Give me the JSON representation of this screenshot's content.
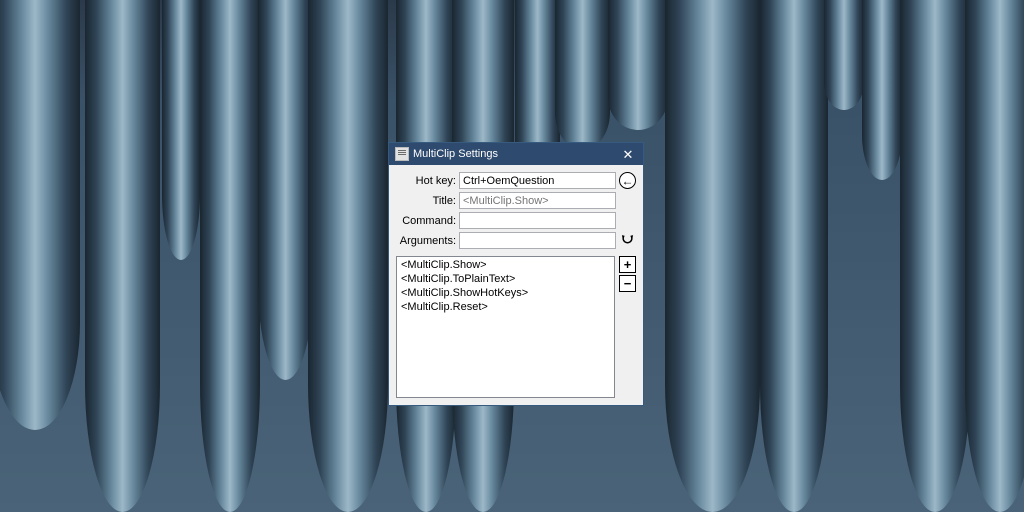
{
  "window": {
    "title": "MultiClip Settings"
  },
  "fields": {
    "labels": {
      "hotkey": "Hot key:",
      "title": "Title:",
      "command": "Command:",
      "arguments": "Arguments:"
    },
    "values": {
      "hotkey": "Ctrl+OemQuestion",
      "title": "",
      "command": "",
      "arguments": ""
    },
    "placeholders": {
      "title": "<MultiClip.Show>"
    }
  },
  "list": {
    "items": [
      "<MultiClip.Show>",
      "<MultiClip.ToPlainText>",
      "<MultiClip.ShowHotKeys>",
      "<MultiClip.Reset>"
    ]
  },
  "buttons": {
    "back": "←",
    "refresh": "↻",
    "add": "+",
    "remove": "−",
    "close": "✕"
  }
}
